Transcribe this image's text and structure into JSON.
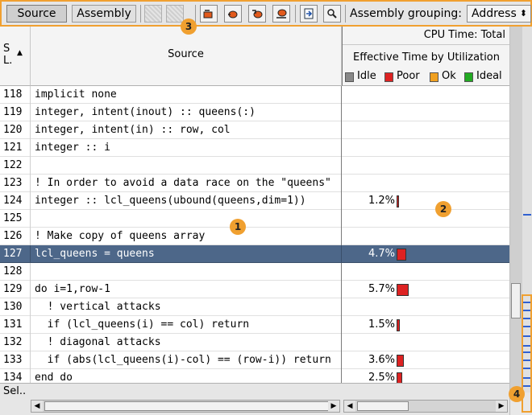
{
  "toolbar": {
    "tab_source": "Source",
    "tab_assembly": "Assembly",
    "grouping_label": "Assembly grouping:",
    "grouping_value": "Address"
  },
  "header": {
    "sl_label": "S L.",
    "source_label": "Source",
    "cpu_time": "CPU Time: Total",
    "effective_time": "Effective Time by Utilization",
    "legend": [
      {
        "label": "Idle",
        "color": "#888888"
      },
      {
        "label": "Poor",
        "color": "#dd2222"
      },
      {
        "label": "Ok",
        "color": "#f0a020"
      },
      {
        "label": "Ideal",
        "color": "#22aa22"
      }
    ]
  },
  "rows": [
    {
      "line": "118",
      "code": "implicit none",
      "value": "",
      "bar": 0
    },
    {
      "line": "119",
      "code": "integer, intent(inout) :: queens(:)",
      "value": "",
      "bar": 0
    },
    {
      "line": "120",
      "code": "integer, intent(in) :: row, col",
      "value": "",
      "bar": 0
    },
    {
      "line": "121",
      "code": "integer :: i",
      "value": "",
      "bar": 0
    },
    {
      "line": "122",
      "code": "",
      "value": "",
      "bar": 0
    },
    {
      "line": "123",
      "code": "! In order to avoid a data race on the \"queens\"",
      "value": "",
      "bar": 0
    },
    {
      "line": "124",
      "code": "integer :: lcl_queens(ubound(queens,dim=1))",
      "value": "1.2%",
      "bar": 1.2
    },
    {
      "line": "125",
      "code": "",
      "value": "",
      "bar": 0
    },
    {
      "line": "126",
      "code": "! Make copy of queens array",
      "value": "",
      "bar": 0
    },
    {
      "line": "127",
      "code": "lcl_queens = queens",
      "value": "4.7%",
      "bar": 4.7,
      "selected": true
    },
    {
      "line": "128",
      "code": "",
      "value": "",
      "bar": 0
    },
    {
      "line": "129",
      "code": "do i=1,row-1",
      "value": "5.7%",
      "bar": 5.7
    },
    {
      "line": "130",
      "code": "  ! vertical attacks",
      "value": "",
      "bar": 0
    },
    {
      "line": "131",
      "code": "  if (lcl_queens(i) == col) return",
      "value": "1.5%",
      "bar": 1.5
    },
    {
      "line": "132",
      "code": "  ! diagonal attacks",
      "value": "",
      "bar": 0
    },
    {
      "line": "133",
      "code": "  if (abs(lcl_queens(i)-col) == (row-i)) return",
      "value": "3.6%",
      "bar": 3.6
    },
    {
      "line": "134",
      "code": "end do",
      "value": "2.5%",
      "bar": 2.5
    }
  ],
  "bottom": {
    "sel_label": "Sel.."
  },
  "callouts": [
    "1",
    "2",
    "3",
    "4"
  ],
  "icons": [
    "search-icon",
    "source-nav-icons",
    "disabled-tool-icons"
  ]
}
